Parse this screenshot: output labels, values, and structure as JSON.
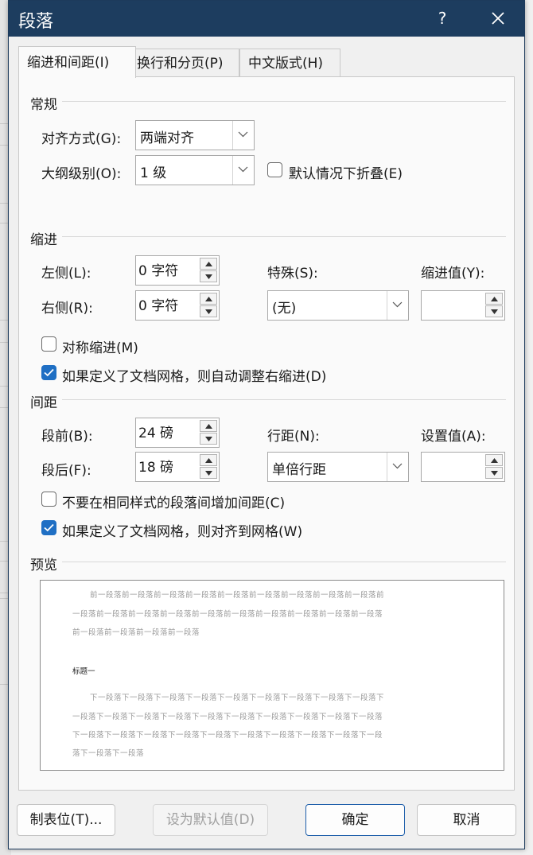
{
  "dialog": {
    "title": "段落",
    "help_label": "?"
  },
  "tabs": [
    {
      "label": "缩进和间距(I)",
      "active": true
    },
    {
      "label": "换行和分页(P)",
      "active": false
    },
    {
      "label": "中文版式(H)",
      "active": false
    }
  ],
  "general": {
    "heading": "常规",
    "alignment": {
      "label": "对齐方式(G):",
      "value": "两端对齐"
    },
    "outline_level": {
      "label": "大纲级别(O):",
      "value": "1 级"
    },
    "collapsed_default": {
      "label": "默认情况下折叠(E)",
      "checked": false
    }
  },
  "indent": {
    "heading": "缩进",
    "left": {
      "label": "左侧(L):",
      "value": "0 字符"
    },
    "right": {
      "label": "右侧(R):",
      "value": "0 字符"
    },
    "special": {
      "label": "特殊(S):",
      "value": "(无)"
    },
    "by": {
      "label": "缩进值(Y):",
      "value": ""
    },
    "mirror": {
      "label": "对称缩进(M)",
      "checked": false
    },
    "auto_adjust": {
      "label": "如果定义了文档网格，则自动调整右缩进(D)",
      "checked": true
    }
  },
  "spacing": {
    "heading": "间距",
    "before": {
      "label": "段前(B):",
      "value": "24 磅"
    },
    "after": {
      "label": "段后(F):",
      "value": "18 磅"
    },
    "line_spacing": {
      "label": "行距(N):",
      "value": "单倍行距"
    },
    "at": {
      "label": "设置值(A):",
      "value": ""
    },
    "no_space_same_style": {
      "label": "不要在相同样式的段落间增加间距(C)",
      "checked": false
    },
    "snap_to_grid": {
      "label": "如果定义了文档网格，则对齐到网格(W)",
      "checked": true
    }
  },
  "preview": {
    "heading": "预览",
    "prev_lines": [
      "前一段落前一段落前一段落前一段落前一段落前一段落前一段落前一段落前一段落前",
      "一段落前一段落前一段落前一段落前一段落前一段落前一段落前一段落前一段落前一段落",
      "前一段落前一段落前一段落前一段落"
    ],
    "sample_title": "标题一",
    "next_lines": [
      "下一段落下一段落下一段落下一段落下一段落下一段落下一段落下一段落下一段落下",
      "一段落下一段落下一段落下一段落下一段落下一段落下一段落下一段落下一段落下一段落",
      "下一段落下一段落下一段落下一段落下一段落下一段落下一段落下一段落下一段落下一段",
      "落下一段落下一段落"
    ]
  },
  "buttons": {
    "tabs": "制表位(T)...",
    "set_default": "设为默认值(D)",
    "ok": "确定",
    "cancel": "取消"
  },
  "colors": {
    "titlebar": "#1d3d5f",
    "accent": "#1f6fc4"
  }
}
